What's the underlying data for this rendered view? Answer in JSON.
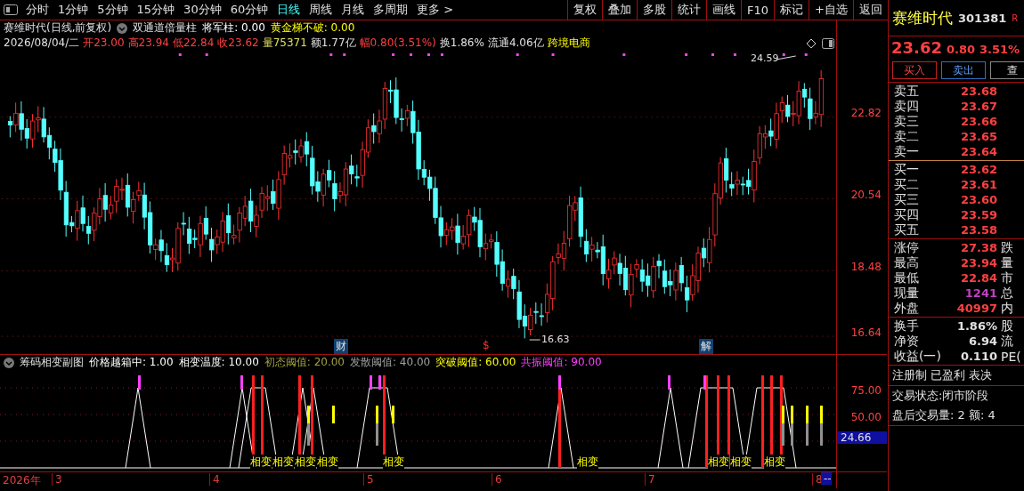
{
  "period_tabs": [
    {
      "label": "分时",
      "selected": false
    },
    {
      "label": "1分钟",
      "selected": false
    },
    {
      "label": "5分钟",
      "selected": false
    },
    {
      "label": "15分钟",
      "selected": false
    },
    {
      "label": "30分钟",
      "selected": false
    },
    {
      "label": "60分钟",
      "selected": false
    },
    {
      "label": "日线",
      "selected": true
    },
    {
      "label": "周线",
      "selected": false
    },
    {
      "label": "月线",
      "selected": false
    },
    {
      "label": "多周期",
      "selected": false
    },
    {
      "label": "更多 >",
      "selected": false
    }
  ],
  "toolbar_buttons": [
    "复权",
    "叠加",
    "多股",
    "统计",
    "画线",
    "F10",
    "标记",
    "+自选",
    "返回"
  ],
  "chart_header": {
    "title": "赛维时代(日线,前复权)",
    "indicator": "双通道倍量柱",
    "params": [
      {
        "text": "将军柱: 0.00",
        "color": "#ffffff"
      },
      {
        "text": "黄金梯不破: 0.00",
        "color": "#ffff00"
      }
    ]
  },
  "quote_line": {
    "date": "2026/08/04/二",
    "fields": [
      {
        "label": "开",
        "value": "23.00",
        "color": "#ff4040"
      },
      {
        "label": "高",
        "value": "23.94",
        "color": "#ff4040"
      },
      {
        "label": "低",
        "value": "22.84",
        "color": "#ff4040"
      },
      {
        "label": "收",
        "value": "23.62",
        "color": "#ff4040"
      },
      {
        "label": "量",
        "value": "75371",
        "color": "#e0e060"
      },
      {
        "label": "额",
        "value": "1.77亿",
        "color": "#e0e0e0"
      },
      {
        "label": "幅",
        "value": "0.80(3.51%)",
        "color": "#ff4040"
      },
      {
        "label": "换",
        "value": "1.86%",
        "color": "#e0e0e0"
      },
      {
        "label": "流通",
        "value": "4.06亿",
        "color": "#e0e0e0"
      }
    ],
    "sector": "跨境电商"
  },
  "price_axis": [
    "22.82",
    "20.54",
    "18.48",
    "16.64"
  ],
  "annotations": {
    "high": "24.59",
    "low": "16.63"
  },
  "event_marks": [
    {
      "text": "财",
      "kind": "box"
    },
    {
      "text": "$",
      "kind": "plain"
    },
    {
      "text": "解",
      "kind": "box"
    }
  ],
  "sub_chart": {
    "title": "筹码相变副图",
    "params": [
      {
        "text": "价格越箱中: 1.00",
        "color": "#ffffff"
      },
      {
        "text": "相变温度: 10.00",
        "color": "#ffffff"
      },
      {
        "text": "初态阈值: 20.00",
        "color": "#a0a040"
      },
      {
        "text": "发散阈值: 40.00",
        "color": "#a0a0a0"
      },
      {
        "text": "突破阈值: 60.00",
        "color": "#ffff00"
      },
      {
        "text": "共振阈值: 90.00",
        "color": "#ff40ff"
      }
    ],
    "axis": [
      "75.00",
      "50.00"
    ],
    "current": "24.66",
    "signals": [
      "相变",
      "相变",
      "相变",
      "相变",
      "相变",
      "相变",
      "相变",
      "相变",
      "相变"
    ]
  },
  "date_axis": {
    "year": "2026年",
    "months": [
      "3",
      "4",
      "5",
      "6",
      "7",
      "8"
    ],
    "tail": "--"
  },
  "quote_panel": {
    "name": "赛维时代",
    "code": "301381",
    "badge": "R",
    "price": "23.62",
    "change": "0.80",
    "percent": "3.51%",
    "buttons": [
      "买入",
      "卖出",
      "查"
    ],
    "asks": [
      {
        "label": "卖五",
        "price": "23.68"
      },
      {
        "label": "卖四",
        "price": "23.67"
      },
      {
        "label": "卖三",
        "price": "23.66"
      },
      {
        "label": "卖二",
        "price": "23.65"
      },
      {
        "label": "卖一",
        "price": "23.64"
      }
    ],
    "bids": [
      {
        "label": "买一",
        "price": "23.62"
      },
      {
        "label": "买二",
        "price": "23.61"
      },
      {
        "label": "买三",
        "price": "23.60"
      },
      {
        "label": "买四",
        "price": "23.59"
      },
      {
        "label": "买五",
        "price": "23.58"
      }
    ],
    "stats": [
      {
        "label": "涨停",
        "value": "27.38",
        "more": "跌",
        "color": "#ff4040"
      },
      {
        "label": "最高",
        "value": "23.94",
        "more": "量",
        "color": "#ff4040"
      },
      {
        "label": "最低",
        "value": "22.84",
        "more": "市",
        "color": "#ff4040"
      },
      {
        "label": "现量",
        "value": "1241",
        "more": "总",
        "color": "#c040c0"
      },
      {
        "label": "外盘",
        "value": "40997",
        "more": "内",
        "color": "#ff4040"
      }
    ],
    "finance": [
      {
        "label": "换手",
        "value": "1.86%",
        "more": "股"
      },
      {
        "label": "净资",
        "value": "6.94",
        "more": "流"
      },
      {
        "label": "收益(一)",
        "value": "0.110",
        "more": "PE("
      }
    ],
    "tags": "注册制 已盈利 表决",
    "status": "交易状态:闭市阶段",
    "after_hours": "盘后交易量: 2  额: 4"
  }
}
